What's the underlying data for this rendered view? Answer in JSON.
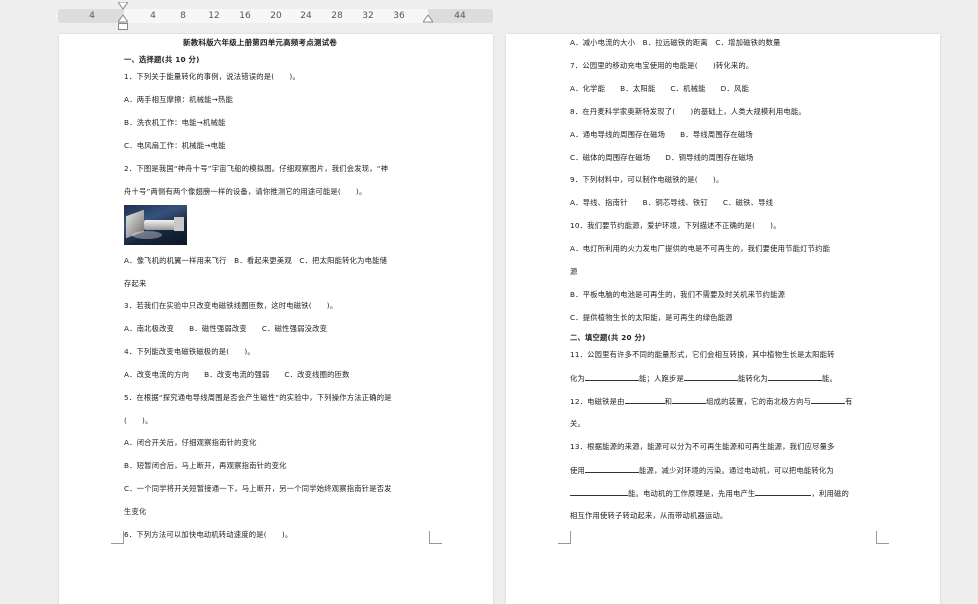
{
  "ruler": {
    "labels": [
      "4",
      "4",
      "8",
      "12",
      "16",
      "20",
      "24",
      "28",
      "32",
      "36",
      "44"
    ]
  },
  "left_page": {
    "title": "新教科版六年级上册第四单元高频考点测试卷",
    "section1": "一、选择题(共 10 分)",
    "q1": "1．下列关于能量转化的事例，说法错误的是(　　)。",
    "q1a": "A．两手相互摩擦：机械能→热能",
    "q1b": "B．洗衣机工作：电能→机械能",
    "q1c": "C．电风扇工作：机械能→电能",
    "q2_line1": "2．下图是我国“神舟十号”宇宙飞船的模拟图。仔细观察图片，我们会发现，“神",
    "q2_line2": "舟十号”两侧有两个像翅膀一样的设备，请你推测它的用途可能是(　　)。",
    "q2_opts1": "A．像飞机的机翼一样用来飞行　B．看起来更美观　C．把太阳能转化为电能储",
    "q2_opts2": "存起来",
    "q3": "3．若我们在实验中只改变电磁铁线圈匝数，这时电磁铁(　　)。",
    "q3_opts": "A．南北极改变　　B．磁性强弱改变　　C．磁性强弱没改变",
    "q4": "4．下列能改变电磁铁磁极的是(　　)。",
    "q4_opts": "A．改变电流的方向　　B．改变电流的强弱　　C．改变线圈的匝数",
    "q5_line1": "5．在根据“探究通电导线周围是否会产生磁性”的实验中，下列操作方法正确的是",
    "q5_line2": "(　　)。",
    "q5a": "A．闭合开关后，仔细观察指南针的变化",
    "q5b": "B．短暂闭合后，马上断开，再观察指南针的变化",
    "q5c_line1": "C．一个同学将开关短暂接通一下，马上断开，另一个同学始终观察指南针是否发",
    "q5c_line2": "生变化",
    "q6": "6．下列方法可以加快电动机转动速度的是(　　)。"
  },
  "right_page": {
    "q6_opts": "A．减小电流的大小　B．拉远磁铁的距离　C．增加磁铁的数量",
    "q7": "7．公园里的移动充电宝使用的电能是(　　)转化来的。",
    "q7_opts": "A．化学能　　B．太阳能　　C．机械能　　D．风能",
    "q8": "8．在丹麦科学家奥斯特发现了(　　)的基础上，人类大规模利用电能。",
    "q8_opts1": "A．通电导线的周围存在磁场　　B．导线周围存在磁场",
    "q8_opts2": "C．磁体的周围存在磁场　　D．铜导线的周围存在磁场",
    "q9": "9．下列材料中，可以制作电磁铁的是(　　)。",
    "q9_opts": "A．导线、指南针　　B．铜芯导线、铁钉　　C．磁铁、导线",
    "q10": "10．我们要节约能源，爱护环境，下列描述不正确的是(　　)。",
    "q10a_line1": "A．电灯所利用的火力发电厂提供的电是不可再生的，我们要使用节能灯节约能",
    "q10a_line2": "源",
    "q10b": "B．平板电脑的电池是可再生的，我们不需要及时关机来节约能源",
    "q10c": "C．提供植物生长的太阳能，是可再生的绿色能源",
    "section2": "二、填空题(共 20 分)",
    "q11_line1": "11．公园里有许多不同的能量形式，它们会相互转换，其中植物生长是太阳能转",
    "q11_line2_a": "化为",
    "q11_line2_b": "能；人跑步是",
    "q11_line2_c": "能转化为",
    "q11_line2_d": "能。",
    "q12_a": "12．电磁铁是由",
    "q12_b": "和",
    "q12_c": "组成的装置，它的南北极方向与",
    "q12_d": "有",
    "q12_line2": "关。",
    "q13_line1": "13．根据能源的来源，能源可以分为不可再生能源和可再生能源，我们应尽量多",
    "q13_line2_a": "使用",
    "q13_line2_b": "能源，减少对环境的污染。通过电动机，可以把电能转化为",
    "q13_line3_a": "能。电动机的工作原理是，先用电产生",
    "q13_line3_b": "，利用磁的",
    "q13_line4": "相互作用使转子转动起来，从而带动机器运动。"
  }
}
